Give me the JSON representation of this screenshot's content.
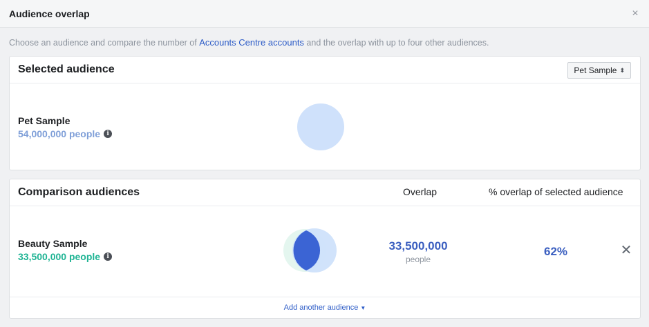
{
  "modal": {
    "title": "Audience overlap",
    "close_glyph": "×"
  },
  "intro": {
    "before": "Choose an audience and compare the number of ",
    "link": "Accounts Centre accounts",
    "after": " and the overlap with up to four other audiences."
  },
  "selected": {
    "heading": "Selected audience",
    "dropdown_value": "Pet Sample",
    "audience_name": "Pet Sample",
    "audience_size": "54,000,000 people"
  },
  "comparison": {
    "heading": "Comparison audiences",
    "col_overlap": "Overlap",
    "col_percent": "% overlap of selected audience",
    "rows": [
      {
        "name": "Beauty Sample",
        "size": "33,500,000 people",
        "overlap_count": "33,500,000",
        "overlap_unit": "people",
        "overlap_percent": "62%"
      }
    ],
    "add_link": "Add another audience"
  },
  "colors": {
    "accent": "#2d5cc7",
    "selected_size": "#7f9fd8",
    "comparison_size": "#1fb494",
    "circle_selected": "#cfe1fb",
    "circle_comparison": "#e4f6ef",
    "circle_intersection": "#3b64d4"
  },
  "icons": {
    "close": "close-icon",
    "info": "info-icon",
    "remove": "remove-icon",
    "dropdown": "caret-updown-icon",
    "add": "caret-down-icon"
  }
}
